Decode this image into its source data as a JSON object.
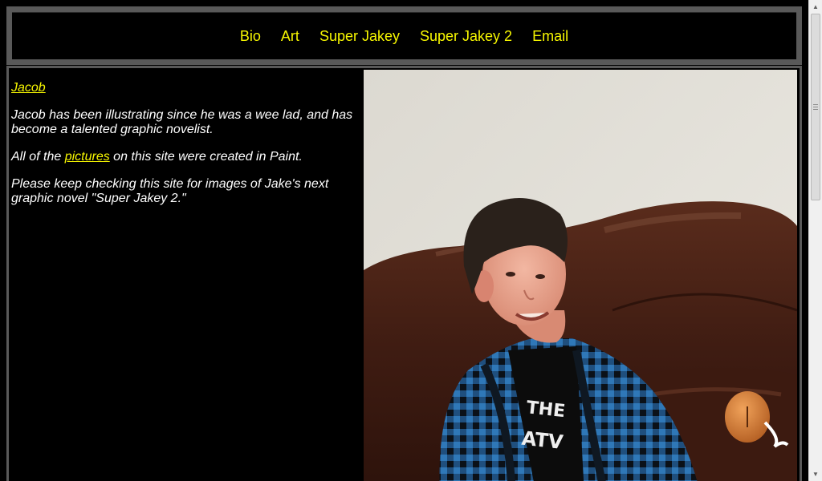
{
  "nav": {
    "items": [
      {
        "label": "Bio"
      },
      {
        "label": "Art"
      },
      {
        "label": "Super Jakey"
      },
      {
        "label": "Super Jakey 2"
      },
      {
        "label": "Email"
      }
    ]
  },
  "bio": {
    "name_link": "Jacob",
    "paragraph1": "Jacob has been illustrating since he was a wee lad, and has become a talented graphic novelist.",
    "paragraph2_prefix": "All of the ",
    "paragraph2_link": "pictures",
    "paragraph2_suffix": " on this site were created in Paint.",
    "paragraph3": "Please keep checking this site for images of Jake's next graphic novel \"Super Jakey 2.\""
  },
  "photo": {
    "shirt_text": "THE ATV"
  },
  "colors": {
    "link": "#f7f700",
    "background": "#000000",
    "frame": "#595959",
    "text": "#ffffff"
  },
  "scrollbar": {
    "up_icon": "arrow-up-icon",
    "down_icon": "arrow-down-icon"
  }
}
